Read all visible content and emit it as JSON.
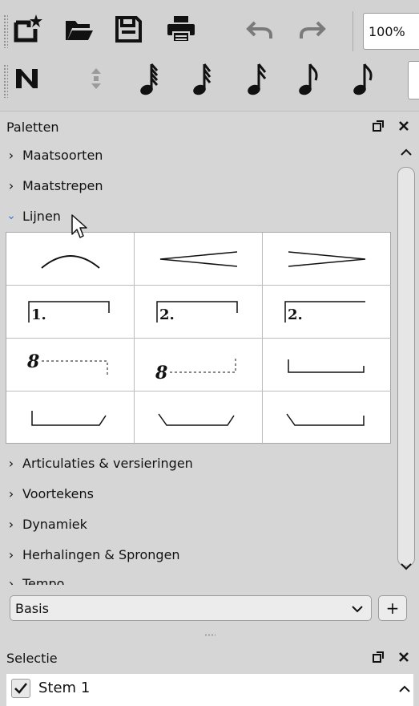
{
  "toolbar": {
    "zoom_value": "100%",
    "row1_icons": [
      "new-score-icon",
      "open-folder-icon",
      "save-icon",
      "print-icon",
      "undo-icon",
      "redo-icon"
    ],
    "row2_icons": [
      "note-input-icon",
      "toggle-arrows-icon",
      "note-64th-icon",
      "note-32nd-icon",
      "note-16th-icon",
      "note-eighth-icon",
      "note-eighth-icon"
    ]
  },
  "palettes": {
    "title": "Paletten",
    "categories_top": [
      {
        "label": "Maatsoorten",
        "expanded": false
      },
      {
        "label": "Maatstrepen",
        "expanded": false
      },
      {
        "label": "Lijnen",
        "expanded": true
      }
    ],
    "grid_cells": [
      {
        "type": "slur"
      },
      {
        "type": "crescendo"
      },
      {
        "type": "diminuendo"
      },
      {
        "type": "volta",
        "label": "1."
      },
      {
        "type": "volta",
        "label": "2."
      },
      {
        "type": "volta-open",
        "label": "2."
      },
      {
        "type": "ottava-alta",
        "label": "8"
      },
      {
        "type": "ottava-bassa",
        "label": "8"
      },
      {
        "type": "pedal-bracket"
      },
      {
        "type": "pedal-bracket-angled-end"
      },
      {
        "type": "pedal-bracket-angled-both"
      },
      {
        "type": "pedal-bracket-angled-start"
      }
    ],
    "categories_bottom": [
      {
        "label": "Articulaties & versieringen"
      },
      {
        "label": "Voortekens"
      },
      {
        "label": "Dynamiek"
      },
      {
        "label": "Herhalingen & Sprongen"
      },
      {
        "label": "Tempo"
      }
    ],
    "workspace": {
      "selected": "Basis",
      "add_label": "+"
    }
  },
  "selection": {
    "title": "Selectie",
    "items": [
      {
        "label": "Stem 1",
        "checked": true
      }
    ]
  }
}
